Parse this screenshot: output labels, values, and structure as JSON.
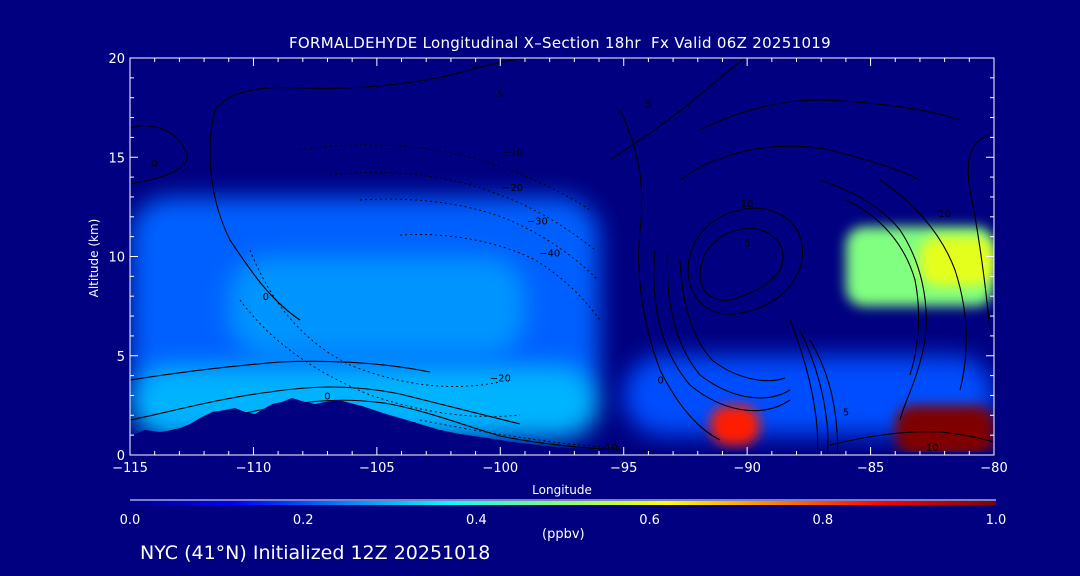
{
  "chart_data": {
    "type": "heatmap",
    "title": "FORMALDEHYDE Longitudinal X–Section 18hr  Fx Valid 06Z 20251019",
    "xlabel": "Longitude",
    "ylabel": "Altitude (km)",
    "xlim": [
      -115,
      -80
    ],
    "ylim": [
      0,
      20
    ],
    "x_ticks": [
      -115,
      -110,
      -105,
      -100,
      -95,
      -90,
      -85,
      -80
    ],
    "x_tick_labels": [
      "−115",
      "−110",
      "−105",
      "−100",
      "−95",
      "−90",
      "−85",
      "−80"
    ],
    "y_ticks": [
      0,
      5,
      10,
      15,
      20
    ],
    "y_tick_labels": [
      "0",
      "5",
      "10",
      "15",
      "20"
    ],
    "colorbar": {
      "label": "(ppbv)",
      "range": [
        0.0,
        1.0
      ],
      "ticks": [
        0.0,
        0.2,
        0.4,
        0.6,
        0.8,
        1.0
      ],
      "tick_labels": [
        "0.0",
        "0.2",
        "0.4",
        "0.6",
        "0.8",
        "1.0"
      ]
    },
    "field_regions": [
      {
        "lon": [
          -115,
          -96
        ],
        "alt": [
          2.5,
          13
        ],
        "value": 0.22
      },
      {
        "lon": [
          -111,
          -99
        ],
        "alt": [
          5,
          10
        ],
        "value": 0.27
      },
      {
        "lon": [
          -115,
          -96
        ],
        "alt": [
          0.8,
          4.5
        ],
        "value": 0.3
      },
      {
        "lon": [
          -95,
          -80
        ],
        "alt": [
          1.0,
          5.0
        ],
        "value": 0.2
      },
      {
        "lon": [
          -86,
          -80
        ],
        "alt": [
          7.5,
          11.5
        ],
        "value": 0.5
      },
      {
        "lon": [
          -83,
          -80
        ],
        "alt": [
          8.5,
          11
        ],
        "value": 0.6
      },
      {
        "lon": [
          -91.5,
          -89.5
        ],
        "alt": [
          0.5,
          2.5
        ],
        "value": 0.85
      },
      {
        "lon": [
          -84,
          -80
        ],
        "alt": [
          0,
          2.5
        ],
        "value": 1.0
      }
    ],
    "contour_labels": [
      {
        "text": "0",
        "lon": -93.5,
        "alt": 3.6
      },
      {
        "text": "0",
        "lon": -107,
        "alt": 2.8
      },
      {
        "text": "0",
        "lon": -103.5,
        "alt": 1.3
      },
      {
        "text": "0",
        "lon": -114,
        "alt": 14.5
      },
      {
        "text": "0",
        "lon": -109.5,
        "alt": 7.8
      },
      {
        "text": "0",
        "lon": -101,
        "alt": 19.5
      },
      {
        "text": "5",
        "lon": -94,
        "alt": 17.5
      },
      {
        "text": "5",
        "lon": -86,
        "alt": 2.0
      },
      {
        "text": "5",
        "lon": -90,
        "alt": 10.5
      },
      {
        "text": "5",
        "lon": -100,
        "alt": 18.0
      },
      {
        "text": "10",
        "lon": -95.5,
        "alt": 0.2
      },
      {
        "text": "10",
        "lon": -82.5,
        "alt": 0.2
      },
      {
        "text": "10",
        "lon": -90,
        "alt": 12.5
      },
      {
        "text": "10",
        "lon": -82,
        "alt": 12.0
      },
      {
        "text": "−10",
        "lon": -99.5,
        "alt": 15.1
      },
      {
        "text": "−20",
        "lon": -99.5,
        "alt": 13.3
      },
      {
        "text": "−30",
        "lon": -98.5,
        "alt": 11.6
      },
      {
        "text": "−40",
        "lon": -98,
        "alt": 10.0
      },
      {
        "text": "−20",
        "lon": -100,
        "alt": 3.7
      }
    ]
  },
  "footer": "NYC (41°N) Initialized 12Z 20251018"
}
